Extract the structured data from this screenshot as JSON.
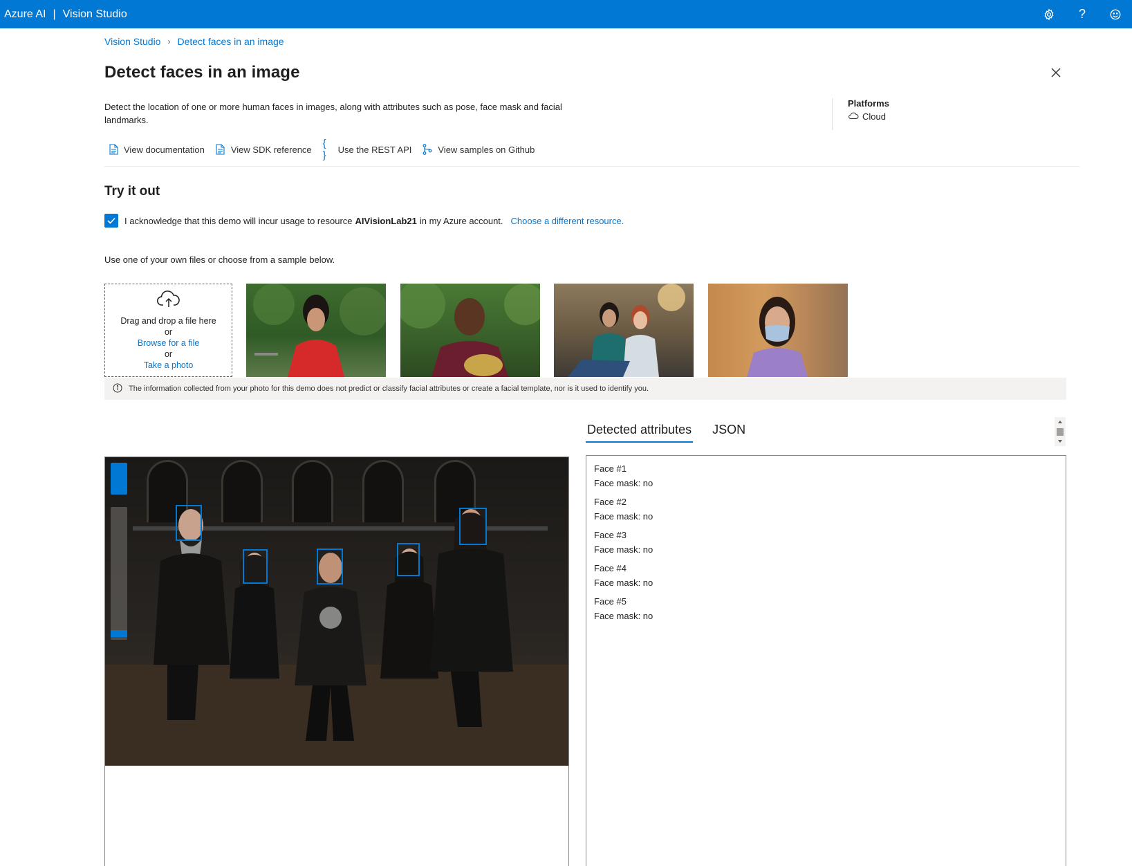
{
  "app": {
    "brand": "Azure AI",
    "product": "Vision Studio"
  },
  "breadcrumb": {
    "root": "Vision Studio",
    "current": "Detect faces in an image"
  },
  "page": {
    "title": "Detect faces in an image",
    "description": "Detect the location of one or more human faces in images, along with attributes such as pose, face mask and facial landmarks."
  },
  "platforms": {
    "title": "Platforms",
    "value": "Cloud"
  },
  "links": [
    {
      "label": "View documentation",
      "icon": "document-icon"
    },
    {
      "label": "View SDK reference",
      "icon": "document-icon"
    },
    {
      "label": "Use the REST API",
      "icon": "braces-icon"
    },
    {
      "label": "View samples on Github",
      "icon": "branch-icon"
    }
  ],
  "tryit": {
    "title": "Try it out",
    "ack_prefix": "I acknowledge that this demo will incur usage to resource",
    "resource": "AIVisionLab21",
    "ack_suffix": "in my Azure account.",
    "choose": "Choose a different resource.",
    "use_text": "Use one of your own files or choose from a sample below."
  },
  "upload": {
    "drag": "Drag and drop a file here",
    "or1": "or",
    "browse": "Browse for a file",
    "or2": "or",
    "photo": "Take a photo"
  },
  "info": "The information collected from your photo for this demo does not predict or classify facial attributes or create a facial template, nor is it used to identify you.",
  "tabs": {
    "detected": "Detected attributes",
    "json": "JSON"
  },
  "faces": [
    {
      "label": "Face #1",
      "mask": "Face mask: no"
    },
    {
      "label": "Face #2",
      "mask": "Face mask: no"
    },
    {
      "label": "Face #3",
      "mask": "Face mask: no"
    },
    {
      "label": "Face #4",
      "mask": "Face mask: no"
    },
    {
      "label": "Face #5",
      "mask": "Face mask: no"
    }
  ],
  "colors": {
    "accent": "#0078d4",
    "topbar": "#0078d4",
    "info_bg": "#f3f2f1"
  }
}
